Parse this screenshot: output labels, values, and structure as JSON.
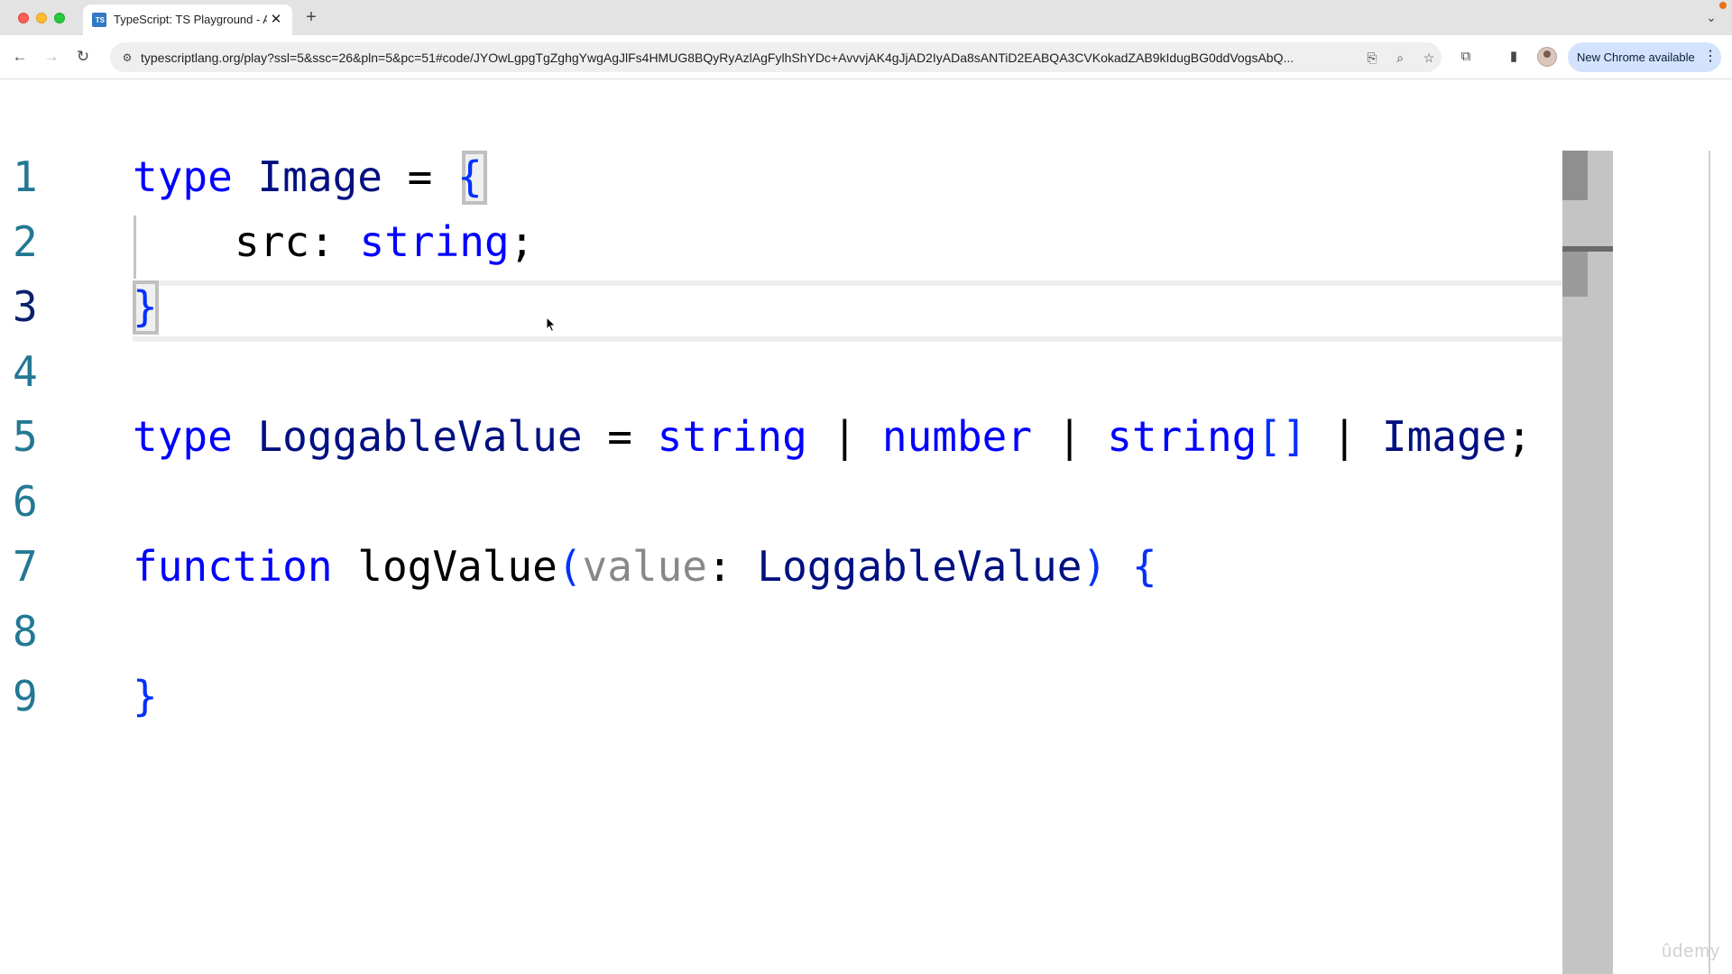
{
  "browser": {
    "tab": {
      "title": "TypeScript: TS Playground - A",
      "favicon_text": "TS",
      "close": "✕"
    },
    "new_tab": "+",
    "tab_search": "⌄",
    "nav": {
      "back": "←",
      "forward": "→",
      "reload": "↻"
    },
    "url": "typescriptlang.org/play?ssl=5&ssc=26&pln=5&pc=51#code/JYOwLgpgTgZghgYwgAgJlFs4HMUG8BQyRyAzlAgFylhShYDc+AvvvjAK4gJjAD2IyADa8sANTiD2EABQA3CVKokadZAB9kIdugBG0ddVogsAbQ...",
    "omnibox_icons": {
      "site_info": "⚙",
      "install": "⎘",
      "zoom": "⌕",
      "bookmark": "☆"
    },
    "toolbar_icons": {
      "extensions": "⧉",
      "sidepanel": "▮"
    },
    "update_label": "New Chrome available",
    "menu": "⋮"
  },
  "editor": {
    "line_numbers": [
      "1",
      "2",
      "3",
      "4",
      "5",
      "6",
      "7",
      "8",
      "9"
    ],
    "active_line": 3
  },
  "code": {
    "l1": {
      "kw": "type",
      "name": "Image",
      "eq": "=",
      "brace": "{"
    },
    "l2": {
      "prop": "src",
      "colon": ":",
      "type": "string",
      "semi": ";"
    },
    "l3": {
      "brace": "}"
    },
    "l5": {
      "kw": "type",
      "name": "LoggableValue",
      "eq": "=",
      "t1": "string",
      "bar": "|",
      "t2": "number",
      "t3": "string",
      "arr": "[]",
      "t4": "Image",
      "semi": ";"
    },
    "l7": {
      "kw": "function",
      "fn": "logValue",
      "lparen": "(",
      "param": "value",
      "colon": ":",
      "ptype": "LoggableValue",
      "rparen": ")",
      "brace": "{"
    },
    "l9": {
      "brace": "}"
    }
  },
  "watermark": "ûdemy"
}
